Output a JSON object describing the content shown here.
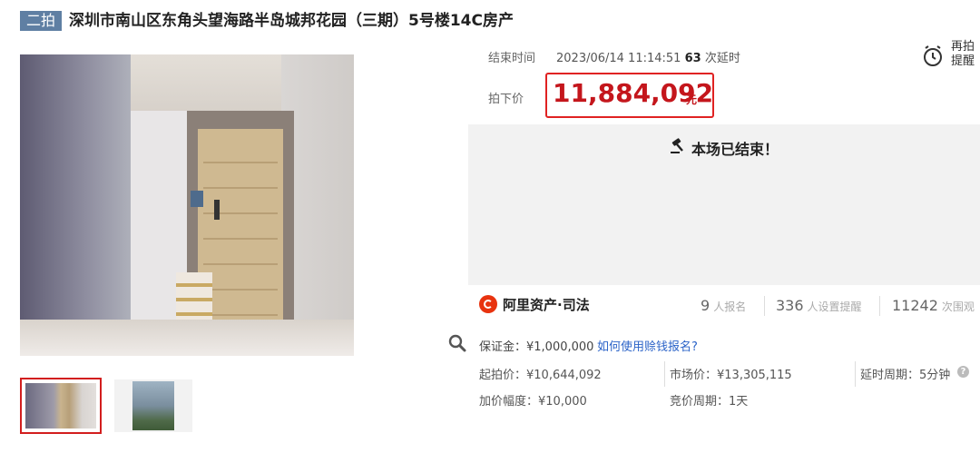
{
  "header": {
    "badge": "二拍",
    "title": "深圳市南山区东角头望海路半岛城邦花园（三期）5号楼14C房产"
  },
  "auction": {
    "end_label": "结束时间",
    "end_time": "2023/06/14 11:14:51",
    "delay_count": "63",
    "delay_suffix": "次延时",
    "remind_line1": "再拍",
    "remind_line2": "提醒",
    "price_label": "拍下价",
    "price": "11,884,092",
    "price_unit": "元",
    "ended_text": "本场已结束！"
  },
  "platform": {
    "name": "阿里资产·司法",
    "stats": [
      {
        "num": "9",
        "unit": "人报名"
      },
      {
        "num": "336",
        "unit": "人设置提醒"
      },
      {
        "num": "11242",
        "unit": "次围观"
      }
    ]
  },
  "details": {
    "deposit": "保证金：¥1,000,000",
    "deposit_link": "如何使用赊钱报名?",
    "start_price": "起拍价：¥10,644,092",
    "market_price": "市场价：¥13,305,115",
    "delay_period": "延时周期：5分钟",
    "increment": "加价幅度：¥10,000",
    "bid_period": "竞价周期：1天",
    "help_icon_text": "?"
  },
  "icons": {
    "zoom": "zoom-icon",
    "alarm": "alarm-clock-icon",
    "gavel": "gavel-icon",
    "help": "help-icon"
  },
  "colors": {
    "price": "#c4161c",
    "highlight_border": "#e02222",
    "badge_bg": "#5f7fa3",
    "link": "#2b63c8"
  }
}
